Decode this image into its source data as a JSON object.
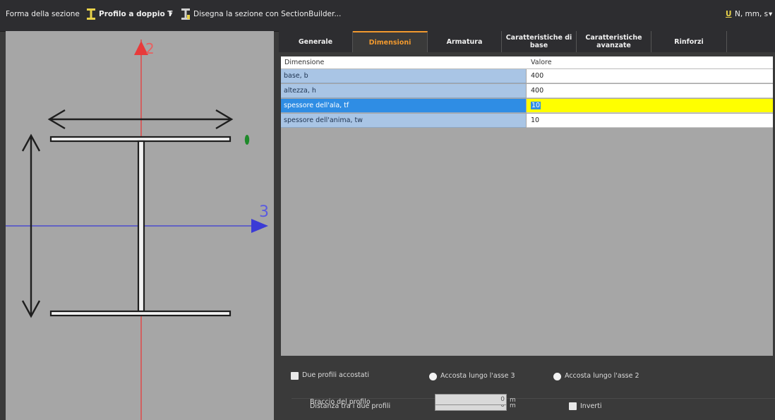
{
  "toolbar": {
    "section_shape_label": "Forma della sezione",
    "profile_label": "Profilo a doppio T",
    "dropdown_arrow": "▾",
    "draw_label": "Disegna la sezione con SectionBuilder...",
    "units_icon_text": "U",
    "units_label": "N, mm, s",
    "units_arrow": "▾"
  },
  "canvas": {
    "axis_2_label": "2",
    "axis_3_label": "3",
    "axis_2_color": "#e83a3a",
    "axis_3_color": "#3b3bd6"
  },
  "tabs": [
    {
      "label": "Generale",
      "active": false
    },
    {
      "label": "Dimensioni",
      "active": true
    },
    {
      "label": "Armatura",
      "active": false
    },
    {
      "label": "Caratteristiche di\nbase",
      "active": false
    },
    {
      "label": "Caratteristiche\navanzate",
      "active": false
    },
    {
      "label": "Rinforzi",
      "active": false
    }
  ],
  "grid": {
    "col_name": "Dimensione",
    "col_value": "Valore",
    "rows": [
      {
        "name": "base, b",
        "value": "400"
      },
      {
        "name": "altezza, h",
        "value": "400"
      },
      {
        "name": "spessore dell'ala, tf",
        "value": "10",
        "selected": true
      },
      {
        "name": "spessore dell'anima, tw",
        "value": "10"
      }
    ]
  },
  "options": {
    "two_profiles_label": "Due profili accostati",
    "along_axis3_label": "Accosta lungo l'asse 3",
    "along_axis2_label": "Accosta lungo l'asse 2",
    "distance_label": "Distanza tra i due profili",
    "distance_value": "0",
    "distance_unit": "m",
    "invert_label": "Inverti",
    "arm_label": "Braccio del profilo",
    "arm_value": "0",
    "arm_unit": "m"
  },
  "colors": {
    "accent_tab": "#f29a2e",
    "selected_row": "#2f8de4",
    "edit_cell": "#ffff00"
  }
}
